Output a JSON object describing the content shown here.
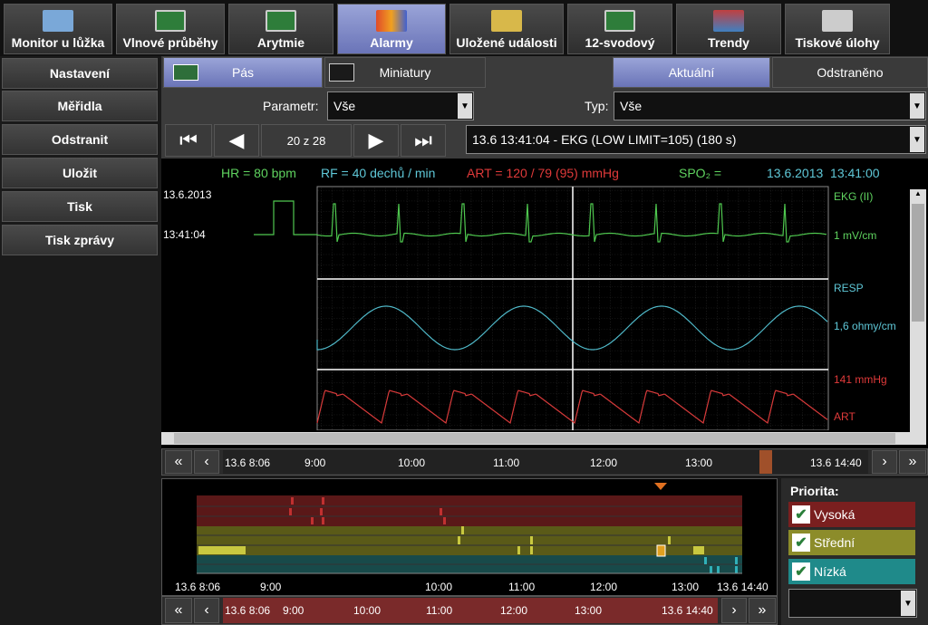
{
  "tabs": [
    {
      "label": "Monitor u lůžka",
      "icon": "bedside-monitor-icon"
    },
    {
      "label": "Vlnové průběhy",
      "icon": "waveform-icon"
    },
    {
      "label": "Arytmie",
      "icon": "arrhythmia-icon"
    },
    {
      "label": "Alarmy",
      "icon": "alarm-icon",
      "active": true
    },
    {
      "label": "Uložené události",
      "icon": "folder-icon"
    },
    {
      "label": "12-svodový",
      "icon": "twelve-lead-icon"
    },
    {
      "label": "Trendy",
      "icon": "trend-chart-icon"
    },
    {
      "label": "Tiskové úlohy",
      "icon": "printer-icon"
    }
  ],
  "sidebar": [
    "Nastavení",
    "Měřidla",
    "Odstranit",
    "Uložit",
    "Tisk",
    "Tisk zprávy"
  ],
  "view": {
    "strip": "Pás",
    "mini": "Miniatury",
    "current": "Aktuální",
    "removed": "Odstraněno"
  },
  "filter": {
    "param_label": "Parametr:",
    "param_value": "Vše",
    "type_label": "Typ:",
    "type_value": "Vše"
  },
  "nav": {
    "counter": "20 z 28",
    "event": "13.6 13:41:04 - EKG (LOW LIMIT=105) (180 s)"
  },
  "vitals": {
    "hr": "HR = 80 bpm",
    "rf": "RF = 40 dechů / min",
    "art": "ART = 120 / 79 (95) mmHg",
    "spo2": "SPO₂ =",
    "datetime": "13.6.2013  13:41:00"
  },
  "wave": {
    "date": "13.6.2013",
    "time": "13:41:04",
    "ekg_label": "EKG  (II)",
    "ekg_scale": "1 mV/cm",
    "resp_label": "RESP",
    "resp_scale": "1,6 ohmy/cm",
    "art_scale": "141 mmHg",
    "art_label": "ART"
  },
  "timeline1": {
    "start": "13.6 8:06",
    "end": "13.6 14:40",
    "ticks": [
      "9:00",
      "10:00",
      "11:00",
      "12:00",
      "13:00"
    ]
  },
  "timeline2": {
    "start": "13.6 8:06",
    "end": "13.6 14:40",
    "ticks": [
      "9:00",
      "10:00",
      "11:00",
      "12:00",
      "13:00"
    ]
  },
  "timeline3": {
    "start": "13.6 8:06",
    "end": "13.6 14:40",
    "ticks": [
      "9:00",
      "10:00",
      "11:00",
      "12:00",
      "13:00"
    ]
  },
  "priority": {
    "title": "Priorita:",
    "high": "Vysoká",
    "medium": "Střední",
    "low": "Nízká"
  },
  "colors": {
    "hr": "#5fd35f",
    "rf": "#5fc8d8",
    "art": "#e03a3a",
    "spo2": "#5fd35f",
    "high": "#7a1f1f",
    "medium": "#8c8c2a",
    "low": "#1f8a8a"
  }
}
